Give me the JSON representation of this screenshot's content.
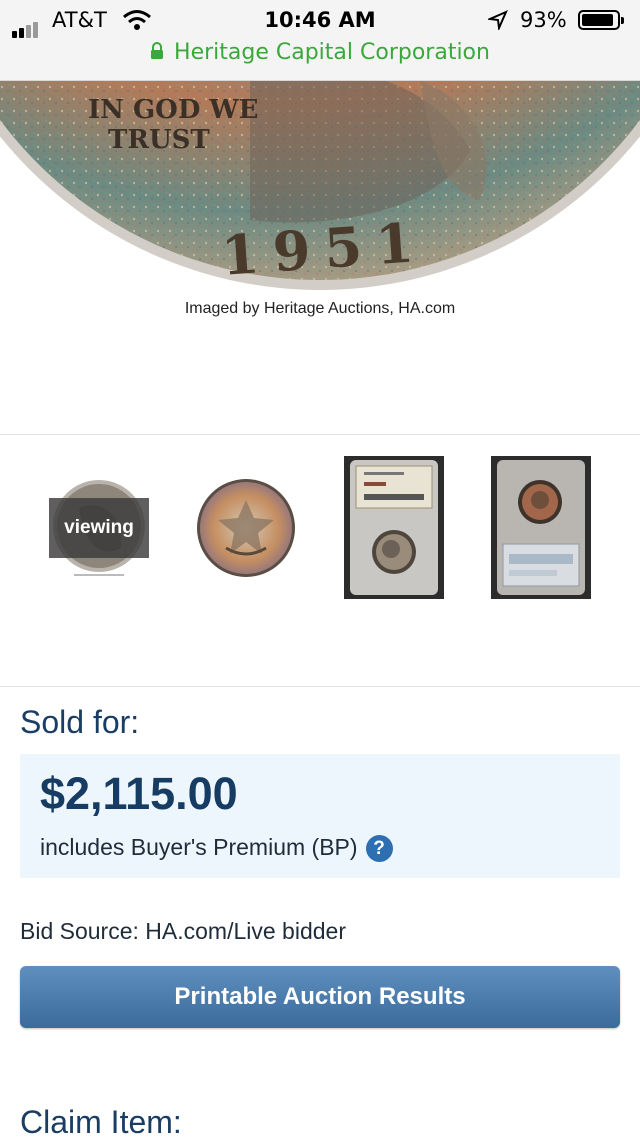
{
  "status_bar": {
    "carrier": "AT&T",
    "time": "10:46 AM",
    "battery_percent": "93%",
    "battery_level": 0.93,
    "signal_bars_filled": 2,
    "signal_bars_total": 4
  },
  "browser": {
    "site_name": "Heritage Capital Corporation",
    "secure": true,
    "secure_color": "#3aa83a"
  },
  "hero_image": {
    "caption": "Imaged by Heritage Auctions, HA.com",
    "coin_text_motto": "IN GOD WE TRUST",
    "coin_text_year": "1951"
  },
  "thumbnails": {
    "active_badge": "viewing",
    "items": [
      {
        "name": "obverse-thumbnail",
        "icon": "coin-obverse"
      },
      {
        "name": "reverse-thumbnail",
        "icon": "coin-reverse"
      },
      {
        "name": "slab-front-thumbnail",
        "icon": "slab-front"
      },
      {
        "name": "slab-back-thumbnail",
        "icon": "slab-back"
      }
    ]
  },
  "sold": {
    "label": "Sold for:",
    "price": "$2,115.00",
    "premium_note": "includes Buyer's Premium (BP)",
    "help_glyph": "?",
    "bid_source": "Bid Source: HA.com/Live bidder",
    "print_button": "Printable Auction Results"
  },
  "claim": {
    "label": "Claim Item:"
  },
  "colors": {
    "heading": "#1a3d63",
    "price_box_bg": "#eef6fd",
    "button": "#4a7aab"
  }
}
